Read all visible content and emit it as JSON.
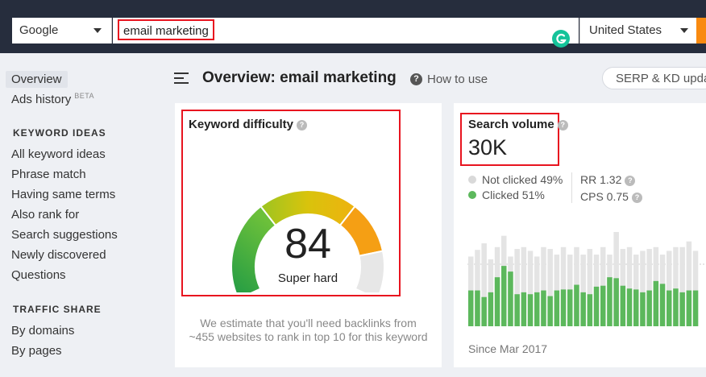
{
  "search_bar": {
    "engine": "Google",
    "query": "email marketing",
    "country": "United States"
  },
  "sidebar": {
    "items_top": [
      {
        "label": "Overview",
        "active": true
      },
      {
        "label": "Ads history",
        "badge": "BETA"
      }
    ],
    "keyword_ideas": {
      "title": "KEYWORD IDEAS",
      "items": [
        "All keyword ideas",
        "Phrase match",
        "Having same terms",
        "Also rank for",
        "Search suggestions",
        "Newly discovered",
        "Questions"
      ]
    },
    "traffic_share": {
      "title": "TRAFFIC SHARE",
      "items": [
        "By domains",
        "By pages"
      ]
    }
  },
  "header": {
    "title": "Overview: email marketing",
    "how_to": "How to use",
    "serp_button": "SERP & KD upda"
  },
  "keyword_difficulty": {
    "title": "Keyword difficulty",
    "score": "84",
    "score_value": 84,
    "label": "Super hard",
    "description_line1": "We estimate that you'll need backlinks from",
    "description_line2": "~455 websites to rank in top 10 for this keyword"
  },
  "search_volume": {
    "title": "Search volume",
    "value": "30K",
    "not_clicked": "Not clicked 49%",
    "clicked": "Clicked 51%",
    "rr": "RR 1.32",
    "cps": "CPS 0.75",
    "since": "Since Mar 2017",
    "colors": {
      "clicked": "#5cb85c",
      "not_clicked": "#e4e4e4",
      "accent": "#f98a10"
    },
    "history": [
      [
        0.74,
        0.38
      ],
      [
        0.81,
        0.38
      ],
      [
        0.88,
        0.31
      ],
      [
        0.71,
        0.36
      ],
      [
        0.84,
        0.52
      ],
      [
        0.96,
        0.64
      ],
      [
        0.74,
        0.58
      ],
      [
        0.82,
        0.34
      ],
      [
        0.84,
        0.36
      ],
      [
        0.8,
        0.34
      ],
      [
        0.74,
        0.36
      ],
      [
        0.84,
        0.38
      ],
      [
        0.82,
        0.32
      ],
      [
        0.76,
        0.38
      ],
      [
        0.84,
        0.39
      ],
      [
        0.76,
        0.39
      ],
      [
        0.84,
        0.44
      ],
      [
        0.76,
        0.36
      ],
      [
        0.82,
        0.34
      ],
      [
        0.76,
        0.42
      ],
      [
        0.84,
        0.43
      ],
      [
        0.76,
        0.52
      ],
      [
        1.0,
        0.51
      ],
      [
        0.82,
        0.43
      ],
      [
        0.84,
        0.4
      ],
      [
        0.76,
        0.39
      ],
      [
        0.8,
        0.36
      ],
      [
        0.82,
        0.38
      ],
      [
        0.84,
        0.48
      ],
      [
        0.76,
        0.45
      ],
      [
        0.8,
        0.38
      ],
      [
        0.84,
        0.4
      ],
      [
        0.84,
        0.36
      ],
      [
        0.9,
        0.38
      ],
      [
        0.8,
        0.38
      ]
    ]
  }
}
